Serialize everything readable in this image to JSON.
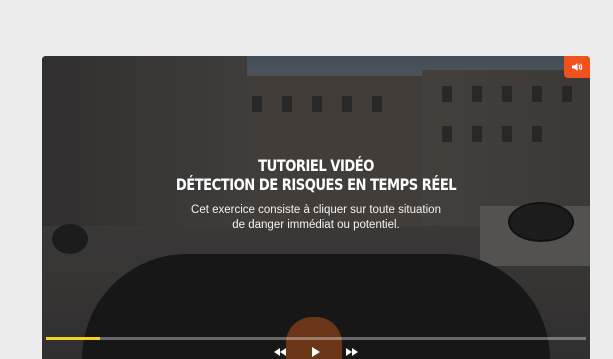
{
  "video": {
    "title_line1": "TUTORIEL VIDÉO",
    "title_line2": "DÉTECTION DE RISQUES EN TEMPS RÉEL",
    "description_line1": "Cet exercice consiste à cliquer sur toute situation",
    "description_line2": "de danger immédiat ou potentiel.",
    "progress_fraction": 0.1
  },
  "icons": {
    "sound": "speaker-icon",
    "rewind": "rewind-icon",
    "play": "play-icon",
    "forward": "fast-forward-icon"
  },
  "colors": {
    "accent": "#f0521e",
    "progress": "#f5d31c",
    "page_bg": "#ececec"
  }
}
